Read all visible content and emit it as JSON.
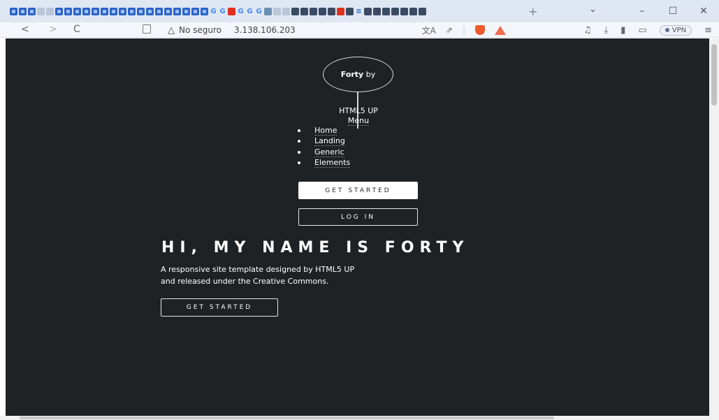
{
  "browser": {
    "tab_colors": {
      "accent": "#2b63c9",
      "red": "#e0301e"
    },
    "new_tab_symbol": "+",
    "window_controls": [
      "–",
      "☐",
      "✕"
    ],
    "nav": {
      "back": "<",
      "forward": ">",
      "reload": "C"
    },
    "omnibox": {
      "security_label": "No seguro",
      "host": "3.138.106.203"
    },
    "vpn_label": "VPN"
  },
  "page": {
    "background": "#1e2225",
    "logo": {
      "bold": "Forty",
      "rest": " by"
    },
    "site_credit": "HTML5 UP",
    "menu_label": "Menu",
    "nav_items": [
      "Home",
      "Landing",
      "Generic",
      "Elements"
    ],
    "get_started_primary": "GET STARTED",
    "log_in": "LOG IN",
    "hero": {
      "title": "HI, MY NAME IS FORTY",
      "line1": "A responsive site template designed by HTML5 UP",
      "line2": "and released under the Creative Commons.",
      "button": "GET STARTED"
    }
  }
}
